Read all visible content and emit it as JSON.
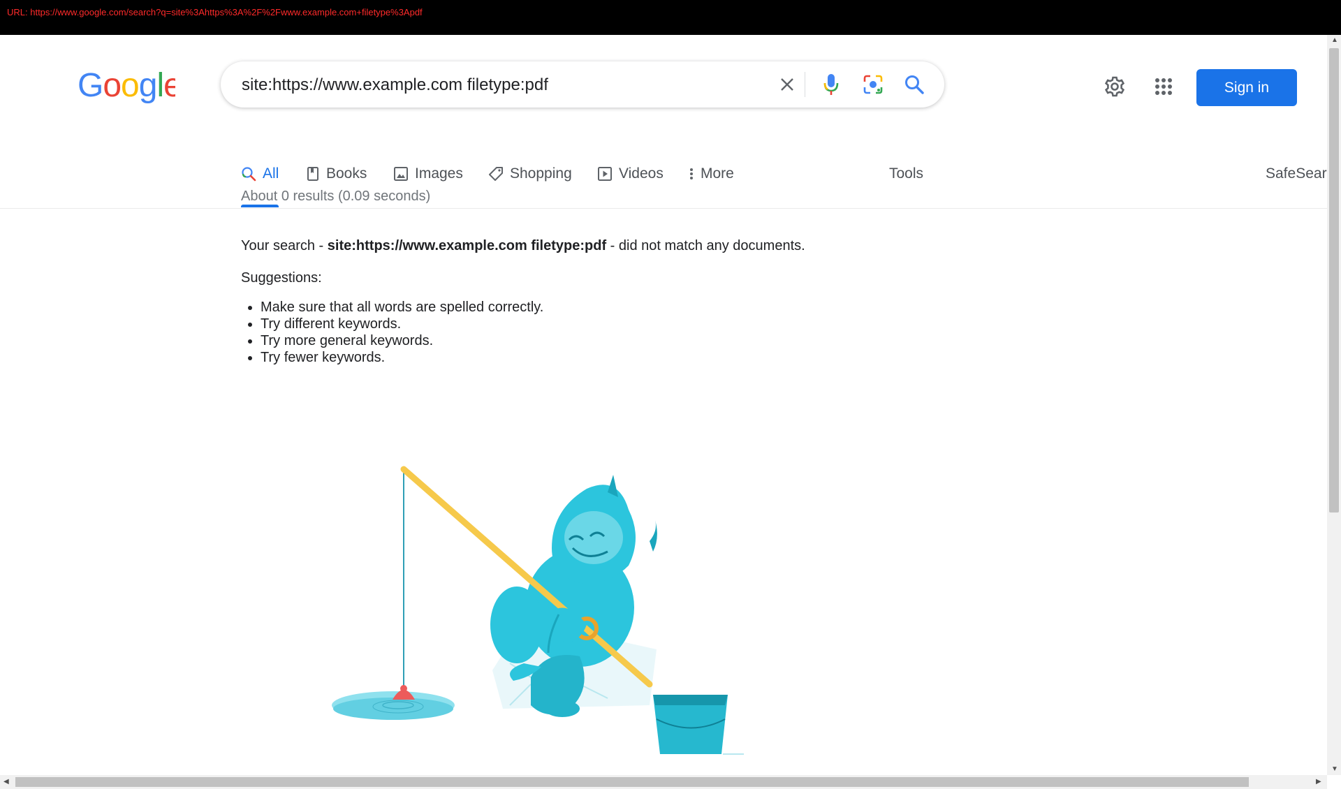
{
  "browser": {
    "url_text": "URL: https://www.google.com/search?q=site%3Ahttps%3A%2F%2Fwww.example.com+filetype%3Apdf"
  },
  "header": {
    "logo_text": "Google",
    "search_query": "site:https://www.example.com filetype:pdf",
    "sign_in_label": "Sign in"
  },
  "tabs": [
    {
      "label": "All",
      "icon": "search-icon",
      "active": true
    },
    {
      "label": "Books",
      "icon": "book-icon"
    },
    {
      "label": "Images",
      "icon": "image-icon"
    },
    {
      "label": "Shopping",
      "icon": "tag-icon"
    },
    {
      "label": "Videos",
      "icon": "video-icon"
    },
    {
      "label": "More",
      "icon": "more-vert-icon"
    }
  ],
  "tools_label": "Tools",
  "safesearch_label": "SafeSear",
  "results": {
    "stats": "About 0 results (0.09 seconds)",
    "message_prefix": "Your search - ",
    "message_query": "site:https://www.example.com filetype:pdf",
    "message_suffix": " - did not match any documents.",
    "suggestions_title": "Suggestions:",
    "suggestions": [
      "Make sure that all words are spelled correctly.",
      "Try different keywords.",
      "Try more general keywords.",
      "Try fewer keywords."
    ]
  },
  "colors": {
    "accent": "#1a73e8",
    "url_text": "#ff2a2a",
    "google_blue": "#4285f4",
    "google_red": "#ea4335",
    "google_yellow": "#fbbc05",
    "google_green": "#34a853"
  }
}
